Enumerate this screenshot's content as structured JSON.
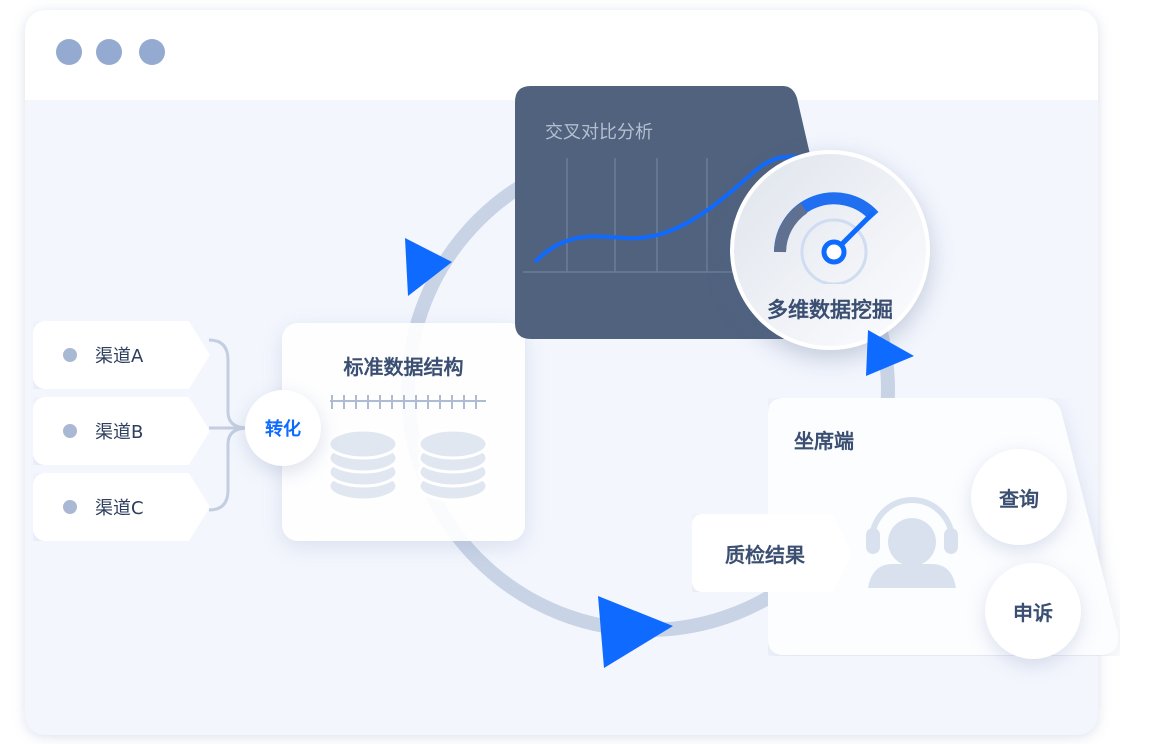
{
  "window": {
    "dots_color": "#94aad0"
  },
  "channels": [
    {
      "label": "渠道A"
    },
    {
      "label": "渠道B"
    },
    {
      "label": "渠道C"
    }
  ],
  "convert": {
    "label": "转化"
  },
  "standard": {
    "title": "标准数据结构"
  },
  "analysis": {
    "title": "交叉对比分析"
  },
  "mining": {
    "label": "多维数据挖掘"
  },
  "agent": {
    "title": "坐席端",
    "result_label": "质检结果",
    "query_label": "查询",
    "appeal_label": "申诉"
  },
  "colors": {
    "accent": "#0f6bff",
    "dark_card": "#50627e",
    "ring": "#c5d0e3",
    "text": "#3a4f72"
  }
}
